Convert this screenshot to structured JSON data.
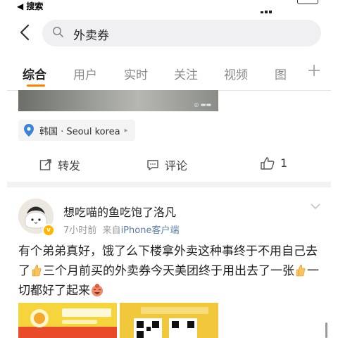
{
  "status_bar": {
    "back_app_label": "◀ 搜索"
  },
  "search": {
    "query": "外卖券"
  },
  "tabs": [
    {
      "label": "综合",
      "active": true
    },
    {
      "label": "用户"
    },
    {
      "label": "实时"
    },
    {
      "label": "关注"
    },
    {
      "label": "视频"
    },
    {
      "label": "图"
    }
  ],
  "accent_color": "#ff8200",
  "prev_post": {
    "location": "韩国 · Seoul korea",
    "actions": {
      "repost": "转发",
      "comment": "评论",
      "like_count": "1"
    }
  },
  "post": {
    "username": "想吃喵的鱼吃饱了洛凡",
    "time": "7小时前",
    "source_prefix": "来自",
    "source": "iPhone客户端",
    "text_parts": [
      "有个弟弟真好，饿了么下楼拿外卖这种事终于不用自己去了",
      "三个月前买的外卖券今天美团终于用出去了一张",
      "一切都好了起来"
    ]
  }
}
